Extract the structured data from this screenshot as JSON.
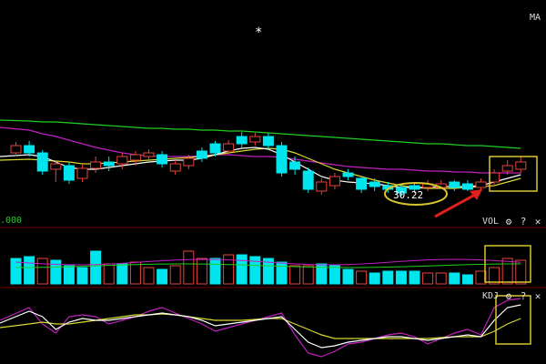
{
  "header": {
    "top_right_label": "MA",
    "marker": "*"
  },
  "price_panel": {
    "left_value_label": ".000",
    "callout_price": "30.22"
  },
  "vol_panel": {
    "name": "VOL",
    "settings_icon": "gear-icon",
    "help_label": "?",
    "close_label": "✕"
  },
  "kdj_panel": {
    "name": "KDJ",
    "settings_icon": "gear-icon",
    "help_label": "?",
    "close_label": "✕"
  },
  "colors": {
    "background": "#000000",
    "up": "#e8433a",
    "down": "#00e5ee",
    "ma_long": "#1fcf1f",
    "ma_mid": "#c020c0",
    "ma_short": "#ffffff",
    "ma_yellow": "#d8d830",
    "highlight_box": "#d8c630",
    "arrow": "#e0201a",
    "panel_line": "#7a0000"
  },
  "chart_data": {
    "type": "candlestick",
    "candles": [
      {
        "d": "up",
        "o": 168,
        "c": 160,
        "h": 156,
        "l": 172
      },
      {
        "d": "down",
        "o": 160,
        "c": 168,
        "h": 155,
        "l": 172
      },
      {
        "d": "down",
        "o": 168,
        "c": 188,
        "h": 165,
        "l": 192
      },
      {
        "d": "up",
        "o": 186,
        "c": 180,
        "h": 176,
        "l": 200
      },
      {
        "d": "down",
        "o": 182,
        "c": 198,
        "h": 178,
        "l": 202
      },
      {
        "d": "up",
        "o": 196,
        "c": 185,
        "h": 180,
        "l": 200
      },
      {
        "d": "up",
        "o": 185,
        "c": 178,
        "h": 172,
        "l": 190
      },
      {
        "d": "down",
        "o": 178,
        "c": 182,
        "h": 172,
        "l": 188
      },
      {
        "d": "up",
        "o": 180,
        "c": 172,
        "h": 168,
        "l": 186
      },
      {
        "d": "up",
        "o": 176,
        "c": 170,
        "h": 166,
        "l": 182
      },
      {
        "d": "up",
        "o": 172,
        "c": 168,
        "h": 164,
        "l": 176
      },
      {
        "d": "down",
        "o": 170,
        "c": 180,
        "h": 166,
        "l": 184
      },
      {
        "d": "up",
        "o": 188,
        "c": 180,
        "h": 176,
        "l": 192
      },
      {
        "d": "up",
        "o": 182,
        "c": 174,
        "h": 170,
        "l": 186
      },
      {
        "d": "down",
        "o": 166,
        "c": 174,
        "h": 162,
        "l": 178
      },
      {
        "d": "down",
        "o": 158,
        "c": 168,
        "h": 155,
        "l": 172
      },
      {
        "d": "up",
        "o": 166,
        "c": 158,
        "h": 154,
        "l": 170
      },
      {
        "d": "down",
        "o": 158,
        "c": 150,
        "h": 145,
        "l": 162
      },
      {
        "d": "up",
        "o": 156,
        "c": 150,
        "h": 146,
        "l": 160
      },
      {
        "d": "down",
        "o": 150,
        "c": 160,
        "h": 146,
        "l": 164
      },
      {
        "d": "down",
        "o": 160,
        "c": 190,
        "h": 156,
        "l": 194
      },
      {
        "d": "down",
        "o": 178,
        "c": 186,
        "h": 172,
        "l": 192
      },
      {
        "d": "down",
        "o": 188,
        "c": 208,
        "h": 184,
        "l": 212
      },
      {
        "d": "up",
        "o": 210,
        "c": 200,
        "h": 196,
        "l": 214
      },
      {
        "d": "up",
        "o": 204,
        "c": 194,
        "h": 190,
        "l": 208
      },
      {
        "d": "down",
        "o": 190,
        "c": 194,
        "h": 186,
        "l": 198
      },
      {
        "d": "down",
        "o": 196,
        "c": 208,
        "h": 194,
        "l": 212
      },
      {
        "d": "down",
        "o": 200,
        "c": 205,
        "h": 196,
        "l": 210
      },
      {
        "d": "down",
        "o": 204,
        "c": 208,
        "h": 200,
        "l": 212
      },
      {
        "d": "down",
        "o": 206,
        "c": 212,
        "h": 202,
        "l": 216
      },
      {
        "d": "down",
        "o": 204,
        "c": 208,
        "h": 200,
        "l": 212
      },
      {
        "d": "up",
        "o": 206,
        "c": 202,
        "h": 198,
        "l": 210
      },
      {
        "d": "up",
        "o": 206,
        "c": 202,
        "h": 198,
        "l": 208
      },
      {
        "d": "down",
        "o": 200,
        "c": 206,
        "h": 198,
        "l": 210
      },
      {
        "d": "down",
        "o": 202,
        "c": 208,
        "h": 198,
        "l": 210
      },
      {
        "d": "up",
        "o": 206,
        "c": 200,
        "h": 196,
        "l": 210
      },
      {
        "d": "up",
        "o": 200,
        "c": 190,
        "h": 186,
        "l": 204
      },
      {
        "d": "up",
        "o": 188,
        "c": 182,
        "h": 176,
        "l": 192
      },
      {
        "d": "up",
        "o": 186,
        "c": 178,
        "h": 172,
        "l": 190
      }
    ],
    "ma_lines": [
      {
        "name": "ma_long",
        "color": "#1fcf1f",
        "y": [
          132,
          133,
          134,
          134,
          135,
          136,
          137,
          138,
          139,
          140,
          141,
          141,
          142,
          142,
          143,
          143,
          144,
          144,
          145,
          146,
          147,
          148,
          149,
          150,
          151,
          152,
          153,
          154,
          155,
          156,
          157,
          158,
          158,
          159,
          160,
          160,
          161,
          162,
          163
        ]
      },
      {
        "name": "ma_mid",
        "color": "#c020c0",
        "y": [
          140,
          143,
          147,
          150,
          154,
          158,
          162,
          165,
          168,
          170,
          171,
          172,
          172,
          172,
          171,
          170,
          170,
          171,
          172,
          172,
          173,
          175,
          177,
          179,
          181,
          183,
          184,
          185,
          186,
          186,
          187,
          188,
          188,
          189,
          189,
          190,
          190,
          190,
          190
        ]
      },
      {
        "name": "ma_yellow",
        "color": "#d8d830",
        "y": [
          176,
          175,
          176,
          177,
          178,
          180,
          180,
          179,
          178,
          177,
          176,
          175,
          174,
          173,
          172,
          170,
          168,
          166,
          164,
          163,
          164,
          168,
          174,
          180,
          186,
          190,
          194,
          198,
          201,
          204,
          206,
          207,
          207,
          207,
          206,
          205,
          204,
          200,
          196
        ]
      },
      {
        "name": "ma_short",
        "color": "#ffffff",
        "y": [
          172,
          170,
          172,
          178,
          184,
          186,
          186,
          184,
          182,
          180,
          178,
          177,
          176,
          176,
          174,
          170,
          166,
          163,
          162,
          164,
          170,
          178,
          186,
          194,
          198,
          200,
          201,
          202,
          204,
          206,
          206,
          206,
          205,
          205,
          205,
          204,
          200,
          196,
          192
        ]
      }
    ],
    "volume": [
      {
        "d": "down",
        "v": 28
      },
      {
        "d": "down",
        "v": 30
      },
      {
        "d": "up",
        "v": 28
      },
      {
        "d": "down",
        "v": 26
      },
      {
        "d": "down",
        "v": 20
      },
      {
        "d": "down",
        "v": 18
      },
      {
        "d": "down",
        "v": 36
      },
      {
        "d": "up",
        "v": 22
      },
      {
        "d": "down",
        "v": 22
      },
      {
        "d": "up",
        "v": 24
      },
      {
        "d": "up",
        "v": 18
      },
      {
        "d": "down",
        "v": 16
      },
      {
        "d": "up",
        "v": 20
      },
      {
        "d": "up",
        "v": 36
      },
      {
        "d": "up",
        "v": 28
      },
      {
        "d": "down",
        "v": 28
      },
      {
        "d": "up",
        "v": 32
      },
      {
        "d": "down",
        "v": 32
      },
      {
        "d": "down",
        "v": 30
      },
      {
        "d": "down",
        "v": 28
      },
      {
        "d": "down",
        "v": 24
      },
      {
        "d": "up",
        "v": 20
      },
      {
        "d": "up",
        "v": 20
      },
      {
        "d": "down",
        "v": 22
      },
      {
        "d": "down",
        "v": 20
      },
      {
        "d": "down",
        "v": 16
      },
      {
        "d": "up",
        "v": 14
      },
      {
        "d": "down",
        "v": 12
      },
      {
        "d": "down",
        "v": 14
      },
      {
        "d": "down",
        "v": 14
      },
      {
        "d": "down",
        "v": 14
      },
      {
        "d": "up",
        "v": 12
      },
      {
        "d": "up",
        "v": 12
      },
      {
        "d": "down",
        "v": 12
      },
      {
        "d": "down",
        "v": 10
      },
      {
        "d": "up",
        "v": 14
      },
      {
        "d": "up",
        "v": 18
      },
      {
        "d": "up",
        "v": 28
      },
      {
        "d": "up",
        "v": 26
      }
    ],
    "kdj": {
      "k": [
        355,
        342,
        348,
        362,
        354,
        350,
        352,
        352,
        350,
        348,
        346,
        344,
        346,
        348,
        352,
        358,
        356,
        354,
        352,
        350,
        348,
        362,
        376,
        382,
        380,
        376,
        374,
        372,
        370,
        370,
        372,
        374,
        372,
        370,
        368,
        370,
        352,
        338,
        335
      ],
      "d": [
        360,
        356,
        354,
        356,
        356,
        354,
        352,
        350,
        348,
        346,
        346,
        345,
        346,
        348,
        350,
        352,
        352,
        352,
        351,
        350,
        350,
        356,
        362,
        368,
        372,
        372,
        372,
        372,
        372,
        372,
        372,
        372,
        371,
        370,
        370,
        370,
        364,
        356,
        350
      ],
      "j": [
        352,
        338,
        356,
        366,
        348,
        346,
        348,
        356,
        352,
        348,
        342,
        338,
        344,
        350,
        356,
        364,
        360,
        356,
        352,
        348,
        344,
        368,
        388,
        392,
        386,
        378,
        376,
        372,
        368,
        366,
        370,
        378,
        372,
        366,
        362,
        368,
        338,
        330,
        328
      ]
    }
  }
}
